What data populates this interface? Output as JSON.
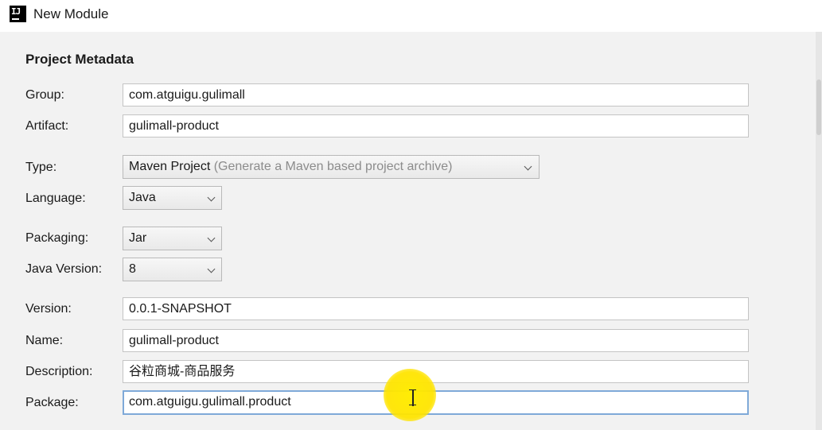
{
  "window": {
    "title": "New Module",
    "logo_text": "IJ"
  },
  "section": {
    "title": "Project Metadata"
  },
  "fields": {
    "group": {
      "label": "Group:",
      "value": "com.atguigu.gulimall"
    },
    "artifact": {
      "label": "Artifact:",
      "value": "gulimall-product"
    },
    "type": {
      "label": "Type:",
      "value": "Maven Project",
      "hint": "(Generate a Maven based project archive)"
    },
    "language": {
      "label": "Language:",
      "value": "Java"
    },
    "packaging": {
      "label": "Packaging:",
      "value": "Jar"
    },
    "java_version": {
      "label": "Java Version:",
      "value": "8"
    },
    "version": {
      "label": "Version:",
      "value": "0.0.1-SNAPSHOT"
    },
    "name": {
      "label": "Name:",
      "value": "gulimall-product"
    },
    "description": {
      "label": "Description:",
      "value": "谷粒商城-商品服务"
    },
    "package": {
      "label": "Package:",
      "value": "com.atguigu.gulimall.product"
    }
  },
  "icons": {
    "dropdown": "chevron-down-icon",
    "cursor": "text-cursor-icon"
  },
  "colors": {
    "focus_border": "#7fa9d8",
    "cursor_highlight": "#ffe600",
    "panel_background": "#f2f2f2"
  }
}
